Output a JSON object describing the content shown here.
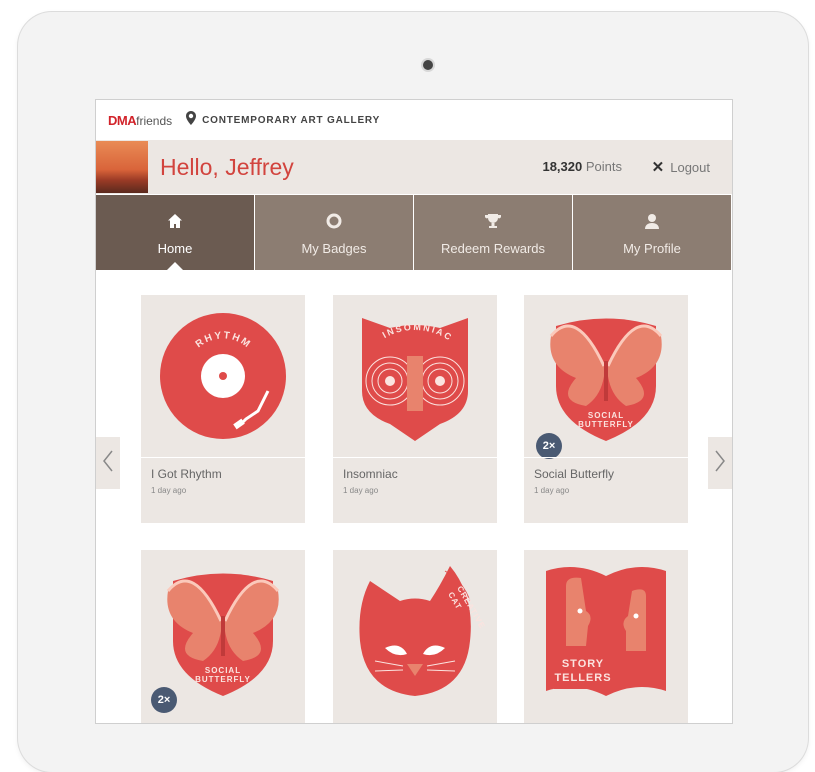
{
  "brand": {
    "dma": "DMA",
    "friends": "friends"
  },
  "location": "CONTEMPORARY ART GALLERY",
  "user": {
    "greeting": "Hello, Jeffrey",
    "points_value": "18,320",
    "points_label": "Points"
  },
  "logout_label": "Logout",
  "nav": [
    {
      "label": "Home",
      "icon": "home-icon"
    },
    {
      "label": "My Badges",
      "icon": "badge-icon"
    },
    {
      "label": "Redeem Rewards",
      "icon": "trophy-icon"
    },
    {
      "label": "My Profile",
      "icon": "profile-icon"
    }
  ],
  "badges": [
    {
      "name": "I Got Rhythm",
      "time": "1 day ago",
      "art_text": "RHYTHM"
    },
    {
      "name": "Insomniac",
      "time": "1 day ago",
      "art_text": "INSOMNIAC"
    },
    {
      "name": "Social Butterfly",
      "time": "1 day ago",
      "art_text": "SOCIAL BUTTERFLY",
      "multiplier": "2×"
    },
    {
      "name": "",
      "time": "",
      "art_text": "SOCIAL BUTTERFLY",
      "multiplier": "2×"
    },
    {
      "name": "",
      "time": "",
      "art_text": "CREATIVE CAT"
    },
    {
      "name": "",
      "time": "",
      "art_text": "STORY TELLERS"
    }
  ],
  "colors": {
    "accent": "#d2443e",
    "nav_bg": "#8c7d72",
    "nav_active": "#6b5b51",
    "card_bg": "#ece7e3",
    "badge_red": "#df4b4a",
    "badge_salmon": "#e8836d",
    "multiplier_bg": "#4a5a73"
  }
}
